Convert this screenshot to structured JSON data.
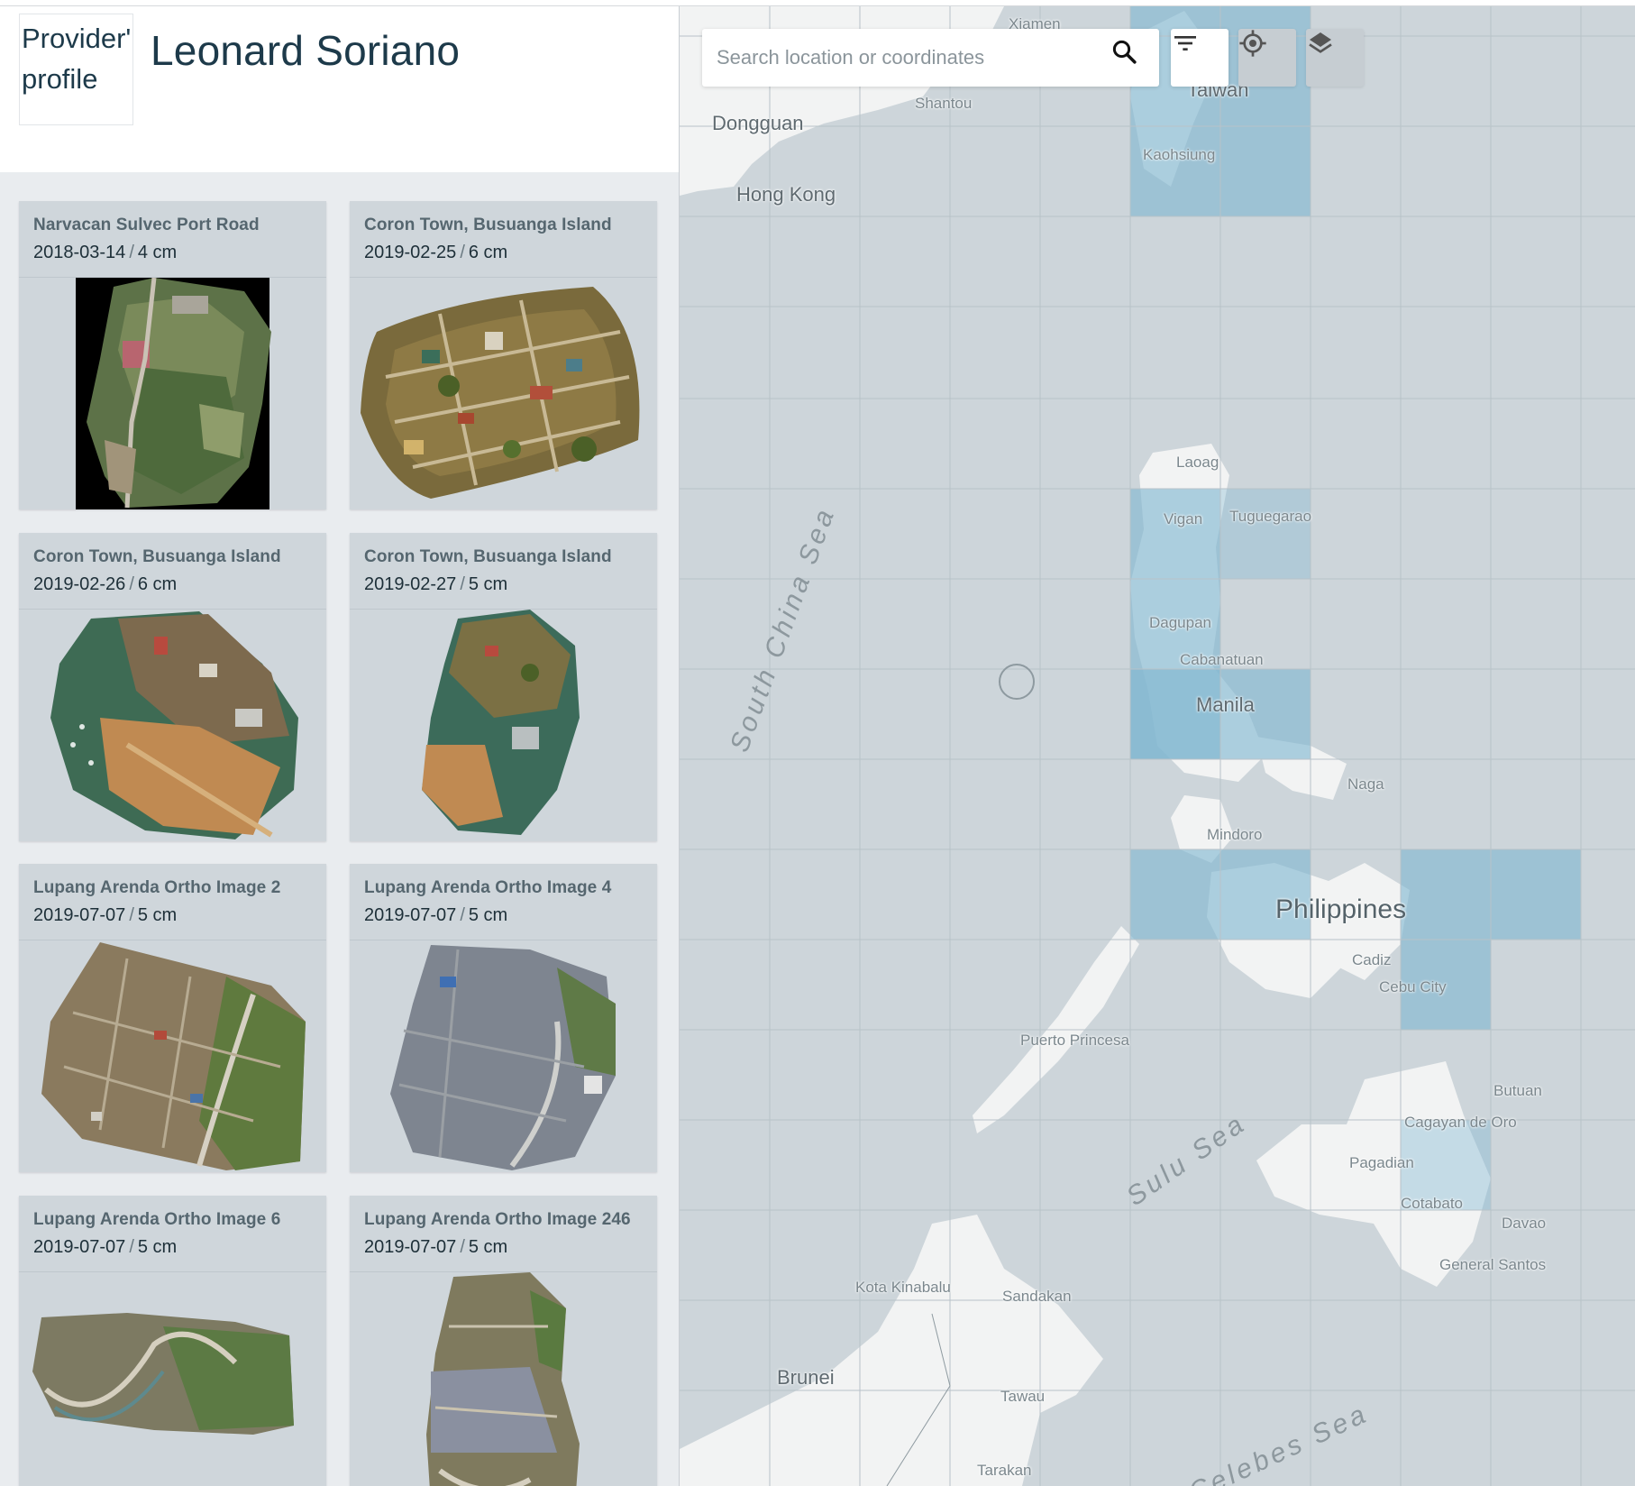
{
  "provider": {
    "image_alt": "Provider' profile",
    "name": "Leonard Soriano"
  },
  "cards": [
    {
      "title": "Narvacan Sulvec Port Road",
      "date": "2018-03-14",
      "sep": "/",
      "resolution": "4 cm"
    },
    {
      "title": "Coron Town, Busuanga Island",
      "date": "2019-02-25",
      "sep": "/",
      "resolution": "6 cm"
    },
    {
      "title": "Coron Town, Busuanga Island",
      "date": "2019-02-26",
      "sep": "/",
      "resolution": "6 cm"
    },
    {
      "title": "Coron Town, Busuanga Island",
      "date": "2019-02-27",
      "sep": "/",
      "resolution": "5 cm"
    },
    {
      "title": "Lupang Arenda Ortho Image 2",
      "date": "2019-07-07",
      "sep": "/",
      "resolution": "5 cm"
    },
    {
      "title": "Lupang Arenda Ortho Image 4",
      "date": "2019-07-07",
      "sep": "/",
      "resolution": "5 cm"
    },
    {
      "title": "Lupang Arenda Ortho Image 6",
      "date": "2019-07-07",
      "sep": "/",
      "resolution": "5 cm"
    },
    {
      "title": "Lupang Arenda Ortho Image 246",
      "date": "2019-07-07",
      "sep": "/",
      "resolution": "5 cm"
    }
  ],
  "map": {
    "search": {
      "placeholder": "Search location or coordinates"
    },
    "icons": {
      "search": "search-icon",
      "filter": "filter-icon",
      "locate": "crosshair-icon",
      "layers": "layers-icon"
    },
    "labels": {
      "xiamen": "Xiamen",
      "taiwan": "Taiwan",
      "shantou": "Shantou",
      "dongguan": "Dongguan",
      "kaohsiung": "Kaohsiung",
      "hong_kong": "Hong Kong",
      "laoag": "Laoag",
      "vigan": "Vigan",
      "tuguegarao": "Tuguegarao",
      "dagupan": "Dagupan",
      "cabanatuan": "Cabanatuan",
      "manila": "Manila",
      "naga": "Naga",
      "mindoro": "Mindoro",
      "philippines": "Philippines",
      "cadiz": "Cadiz",
      "cebu_city": "Cebu City",
      "puerto_princesa": "Puerto Princesa",
      "butuan": "Butuan",
      "cagayan_de_oro": "Cagayan de Oro",
      "pagadian": "Pagadian",
      "cotabato": "Cotabato",
      "davao": "Davao",
      "general_santos": "General Santos",
      "kota_kinabalu": "Kota Kinabalu",
      "sandakan": "Sandakan",
      "brunei": "Brunei",
      "tawau": "Tawau",
      "tarakan": "Tarakan",
      "south_china_sea": "South China Sea",
      "sulu_sea": "Sulu Sea",
      "celebes_sea": "Celebes Sea"
    },
    "colors": {
      "water": "#cdd5da",
      "land": "#f2f3f3",
      "coverage": "#7fb6d1",
      "grid": "#b8c2c8"
    }
  }
}
